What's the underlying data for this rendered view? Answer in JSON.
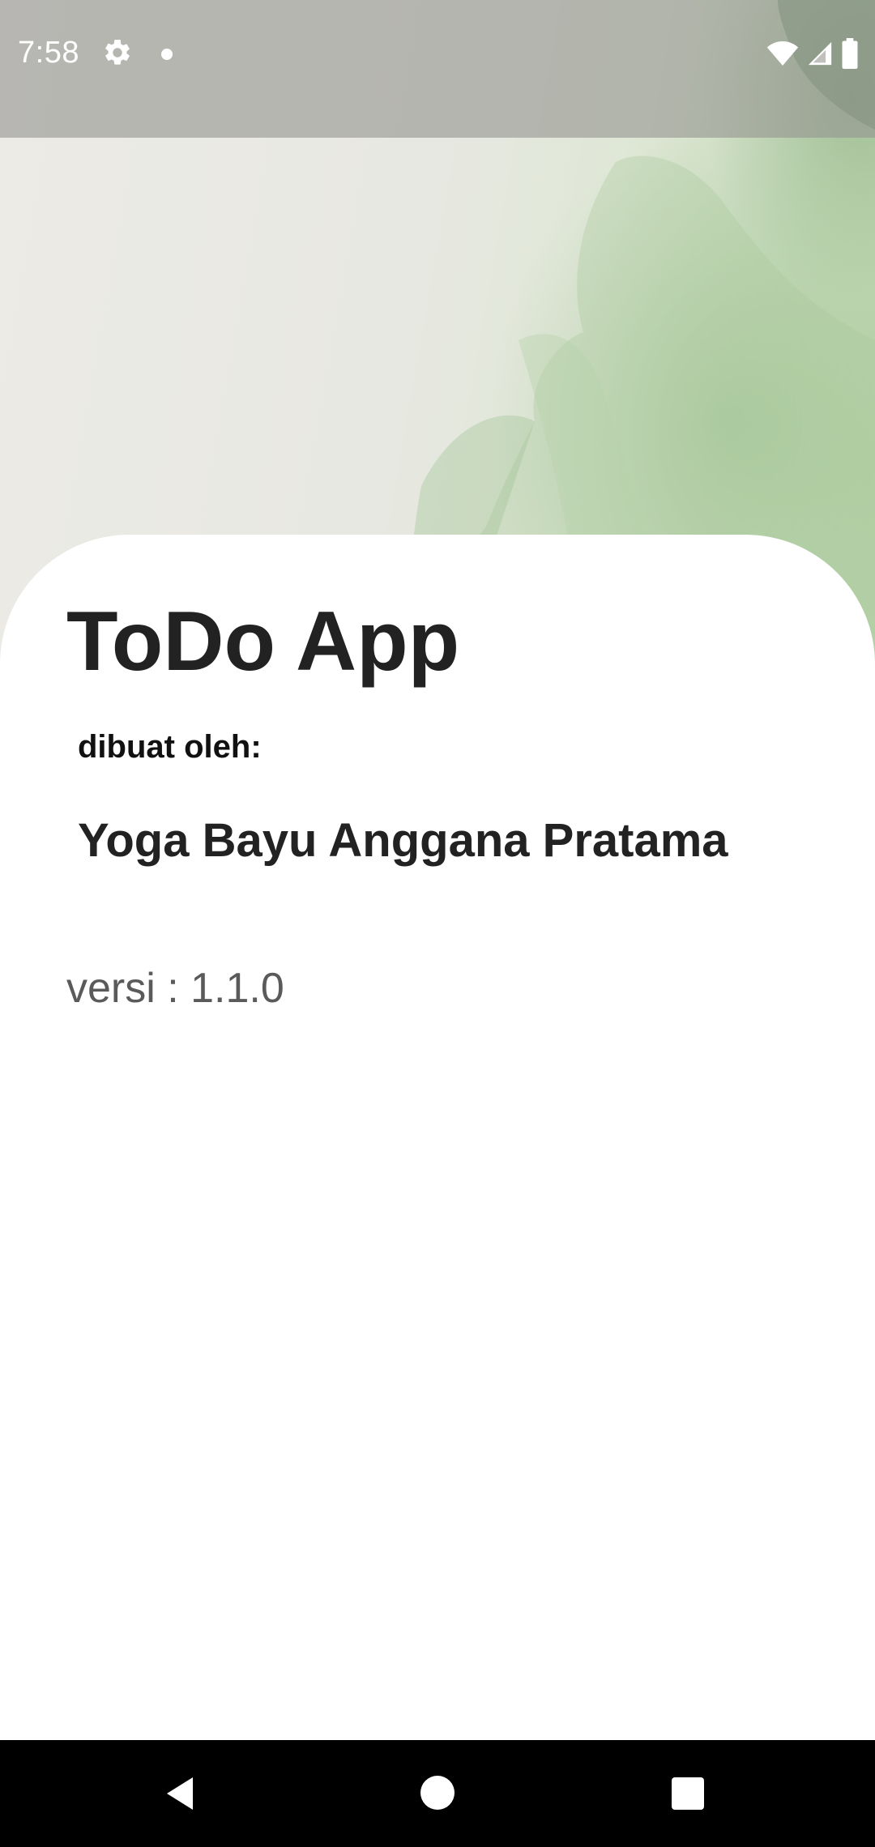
{
  "status_bar": {
    "time": "7:58",
    "icons": [
      "gear-icon",
      "notification-dot-icon",
      "wifi-icon",
      "cellular-signal-icon",
      "battery-icon"
    ]
  },
  "about": {
    "app_title": "ToDo App",
    "made_by_label": "dibuat oleh:",
    "author_name": "Yoga Bayu Anggana Pratama",
    "version_text": "versi : 1.1.0"
  },
  "nav_bar": {
    "icons": [
      "back-icon",
      "home-icon",
      "recents-icon"
    ]
  },
  "colors": {
    "status_bar_overlay": "#969691",
    "card_background": "#ffffff",
    "title_text": "#222222",
    "version_text": "#5a5a5a",
    "leaf_green": "#b8d3ab",
    "nav_bar": "#000000"
  }
}
